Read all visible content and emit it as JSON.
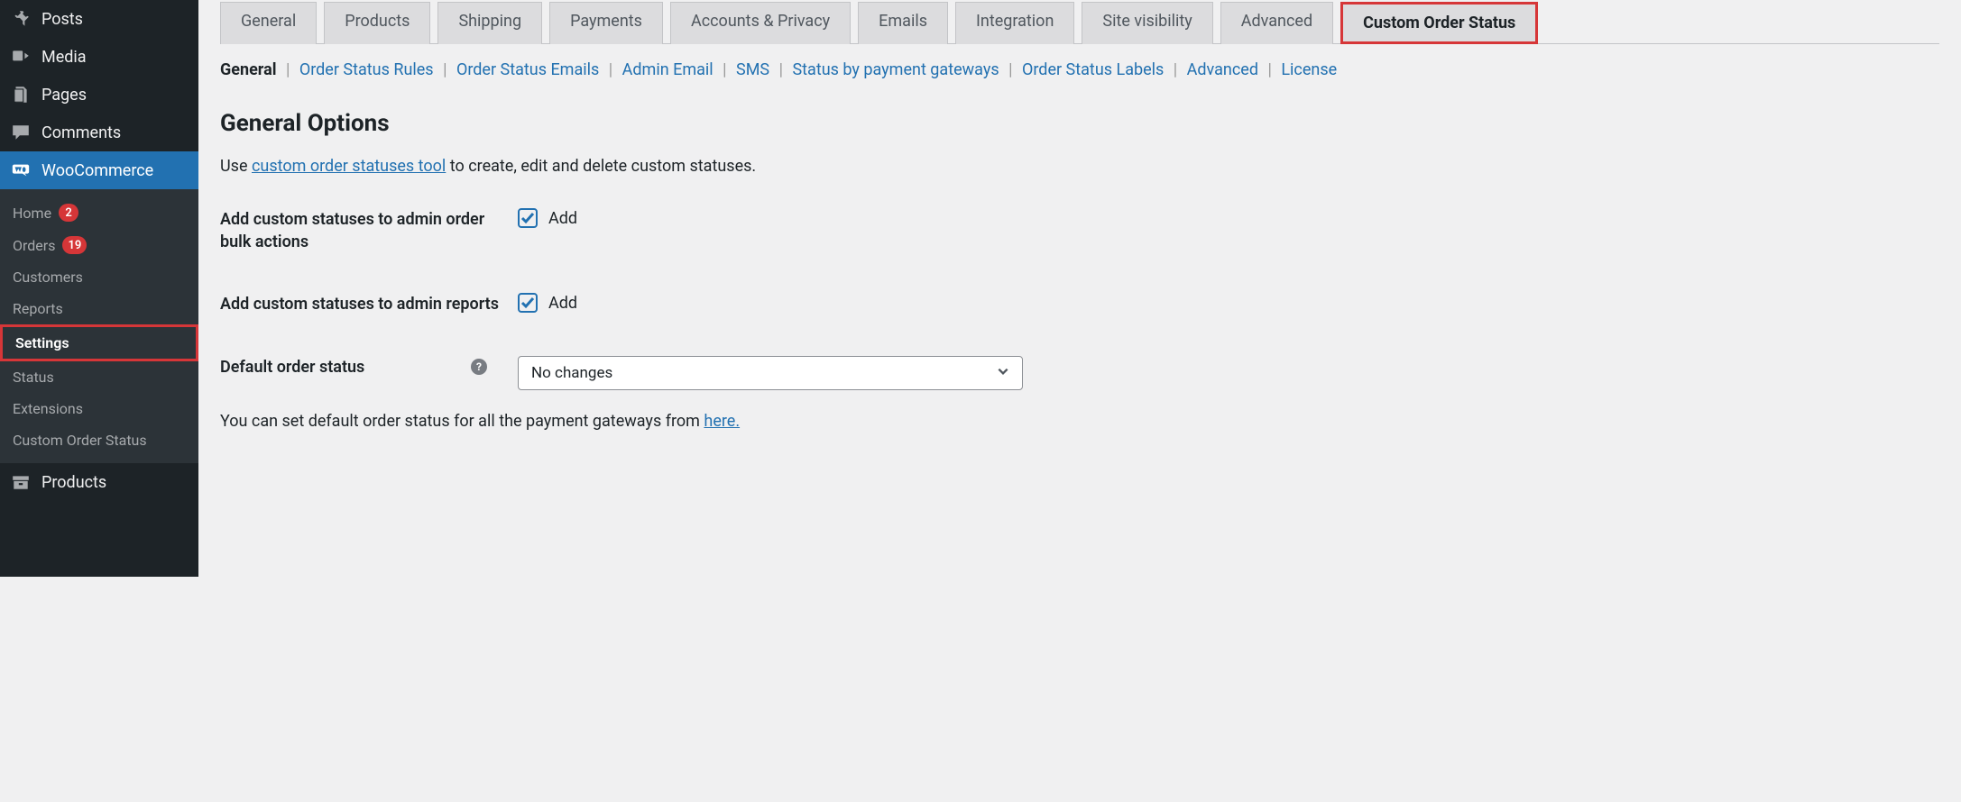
{
  "sidebar": {
    "top": [
      {
        "label": "Posts",
        "icon": "pin"
      },
      {
        "label": "Media",
        "icon": "media"
      },
      {
        "label": "Pages",
        "icon": "page"
      },
      {
        "label": "Comments",
        "icon": "comment"
      }
    ],
    "woocommerce": {
      "label": "WooCommerce"
    },
    "submenu": [
      {
        "label": "Home",
        "badge": "2"
      },
      {
        "label": "Orders",
        "badge": "19"
      },
      {
        "label": "Customers"
      },
      {
        "label": "Reports"
      },
      {
        "label": "Settings",
        "current": true,
        "highlight": true
      },
      {
        "label": "Status"
      },
      {
        "label": "Extensions"
      },
      {
        "label": "Custom Order Status"
      }
    ],
    "bottom": [
      {
        "label": "Products",
        "icon": "archive"
      }
    ]
  },
  "tabs": [
    "General",
    "Products",
    "Shipping",
    "Payments",
    "Accounts & Privacy",
    "Emails",
    "Integration",
    "Site visibility",
    "Advanced",
    "Custom Order Status"
  ],
  "tabs_highlighted_index": 9,
  "subtabs": [
    "General",
    "Order Status Rules",
    "Order Status Emails",
    "Admin Email",
    "SMS",
    "Status by payment gateways",
    "Order Status Labels",
    "Advanced",
    "License"
  ],
  "subtabs_current_index": 0,
  "section": {
    "title": "General Options",
    "desc_prefix": "Use ",
    "desc_link": "custom order statuses tool",
    "desc_suffix": " to create, edit and delete custom statuses."
  },
  "fields": {
    "bulk": {
      "label": "Add custom statuses to admin order bulk actions",
      "checkbox_label": "Add",
      "checked": true
    },
    "reports": {
      "label": "Add custom statuses to admin reports",
      "checkbox_label": "Add",
      "checked": true
    },
    "default_status": {
      "label": "Default order status",
      "value": "No changes"
    }
  },
  "hint": {
    "prefix": "You can set default order status for all the payment gateways from ",
    "link": "here."
  }
}
